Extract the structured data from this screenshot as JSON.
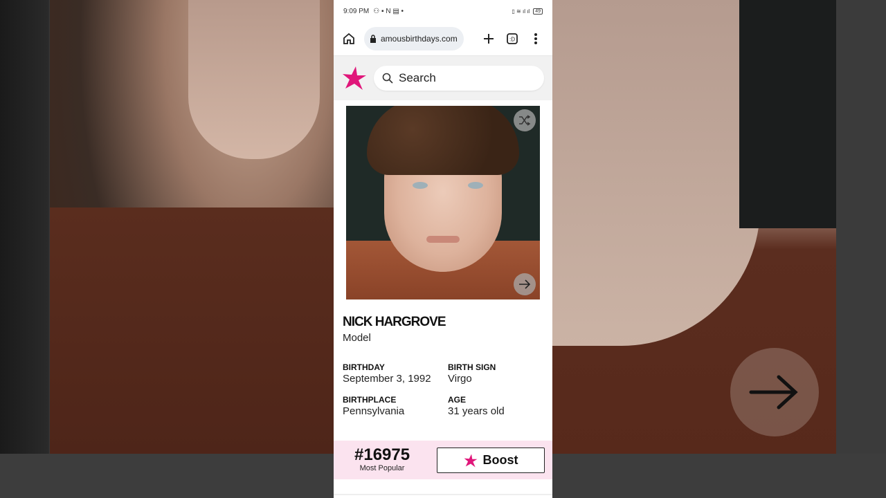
{
  "status_bar": {
    "time": "9:09 PM",
    "battery": "49"
  },
  "browser": {
    "url": "amousbirthdays.com"
  },
  "site": {
    "search_placeholder": "Search",
    "brand_color": "#e0167a"
  },
  "profile": {
    "name": "NICK HARGROVE",
    "profession": "Model",
    "facts": [
      {
        "label": "BIRTHDAY",
        "value": "September 3, 1992"
      },
      {
        "label": "BIRTH SIGN",
        "value": "Virgo"
      },
      {
        "label": "BIRTHPLACE",
        "value": "Pennsylvania"
      },
      {
        "label": "AGE",
        "value": "31 years old"
      }
    ]
  },
  "popularity": {
    "rank": "#16975",
    "rank_label": "Most Popular",
    "boost_label": "Boost"
  },
  "icons": [
    "home-icon",
    "lock-icon",
    "plus-icon",
    "tabs-icon",
    "menu-icon",
    "search-icon",
    "star-logo-icon",
    "shuffle-icon",
    "arrow-right-icon"
  ]
}
